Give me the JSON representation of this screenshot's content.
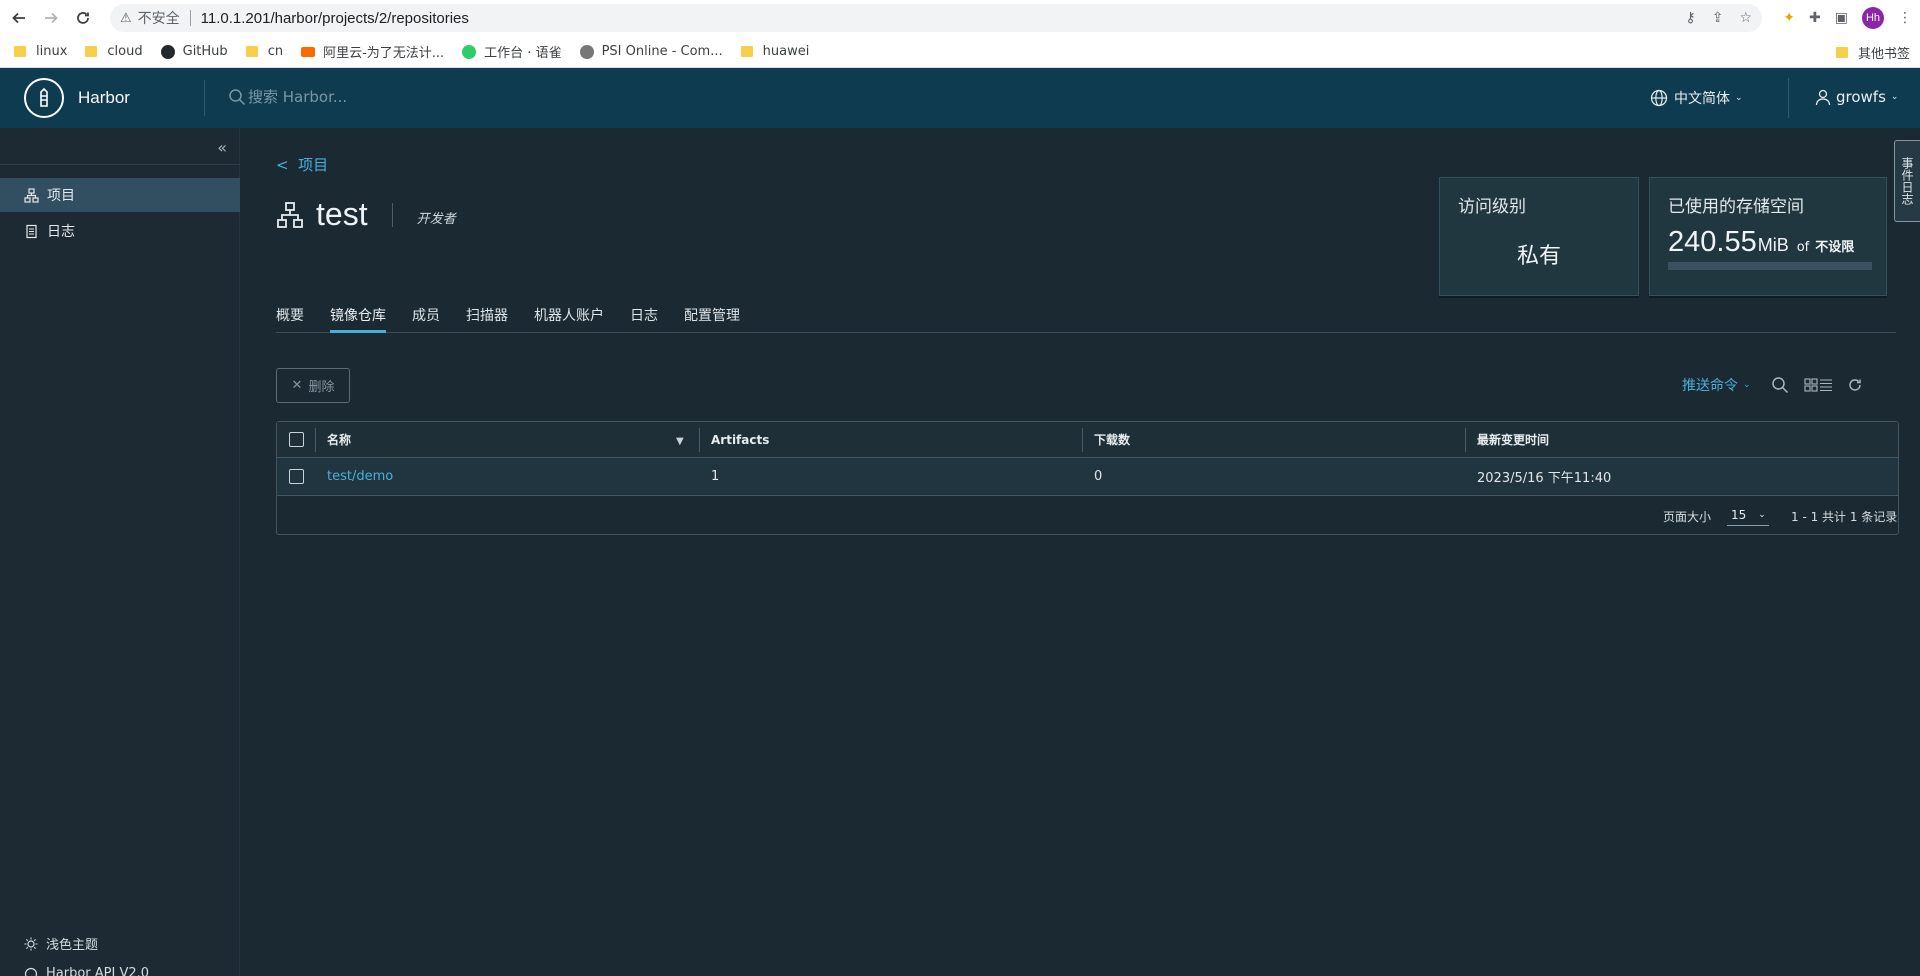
{
  "browser": {
    "insecure_label": "不安全",
    "url": "11.0.1.201/harbor/projects/2/repositories",
    "profile_initials": "Hh",
    "bookmarks": [
      {
        "label": "linux",
        "icon": "folder-icon"
      },
      {
        "label": "cloud",
        "icon": "folder-icon"
      },
      {
        "label": "GitHub",
        "icon": "github-icon"
      },
      {
        "label": "cn",
        "icon": "folder-icon"
      },
      {
        "label": "阿里云-为了无法计...",
        "icon": "aliyun-icon"
      },
      {
        "label": "工作台 · 语雀",
        "icon": "yuque-icon"
      },
      {
        "label": "PSI Online - Com...",
        "icon": "psi-icon"
      },
      {
        "label": "huawei",
        "icon": "folder-icon"
      }
    ],
    "other_bookmarks": "其他书签"
  },
  "header": {
    "app_name": "Harbor",
    "search_placeholder": "搜索 Harbor...",
    "language": "中文简体",
    "username": "growfs"
  },
  "sidebar": {
    "items": [
      {
        "label": "项目",
        "icon": "projects-icon",
        "active": true
      },
      {
        "label": "日志",
        "icon": "logs-icon",
        "active": false
      }
    ],
    "theme": "浅色主题",
    "api": "Harbor API V2.0"
  },
  "project": {
    "back_label": "项目",
    "name": "test",
    "role": "开发者"
  },
  "cards": {
    "access_title": "访问级别",
    "access_value": "私有",
    "storage_title": "已使用的存储空间",
    "storage_value": "240.55",
    "storage_unit": "MiB",
    "storage_of": "of",
    "storage_limit": "不设限"
  },
  "tabs": [
    {
      "label": "概要",
      "active": false
    },
    {
      "label": "镜像仓库",
      "active": true
    },
    {
      "label": "成员",
      "active": false
    },
    {
      "label": "扫描器",
      "active": false
    },
    {
      "label": "机器人账户",
      "active": false
    },
    {
      "label": "日志",
      "active": false
    },
    {
      "label": "配置管理",
      "active": false
    }
  ],
  "toolbar": {
    "delete_label": "删除",
    "push_command": "推送命令"
  },
  "table": {
    "columns": [
      "名称",
      "Artifacts",
      "下载数",
      "最新变更时间"
    ],
    "rows": [
      {
        "name": "test/demo",
        "artifacts": "1",
        "pulls": "0",
        "updated": "2023/5/16 下午11:40"
      }
    ],
    "page_size_label": "页面大小",
    "page_size": "15",
    "count_text": "1 - 1 共计 1 条记录"
  },
  "side_tab": "事件日志",
  "colors": {
    "header_bg": "#0e3b4f",
    "page_bg": "#1b2a32",
    "accent": "#4aaed9"
  }
}
